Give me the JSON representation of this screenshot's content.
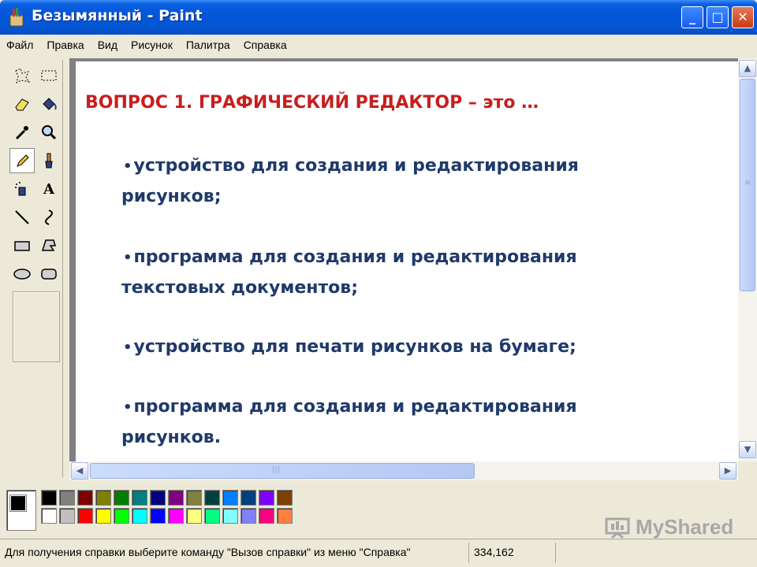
{
  "window": {
    "title": "Безымянный - Paint",
    "minimize_label": "_",
    "maximize_label": "□",
    "close_label": "✕"
  },
  "menu": [
    "Файл",
    "Правка",
    "Вид",
    "Рисунок",
    "Палитра",
    "Справка"
  ],
  "toolbox": {
    "selected_tool": "pencil-icon",
    "tools": [
      "free-select-icon",
      "rect-select-icon",
      "eraser-icon",
      "fill-icon",
      "color-picker-icon",
      "magnifier-icon",
      "pencil-icon",
      "brush-icon",
      "airbrush-icon",
      "text-icon",
      "line-icon",
      "curve-icon",
      "rectangle-icon",
      "polygon-icon",
      "ellipse-icon",
      "rounded-rect-icon"
    ],
    "text_tool_glyph": "A"
  },
  "canvas": {
    "question": "ВОПРОС 1. ГРАФИЧЕСКИЙ РЕДАКТОР  – это …",
    "answers": [
      [
        "устройство для создания и редактирования",
        "рисунков;"
      ],
      [
        "программа  для создания и редактирования",
        "текстовых документов;"
      ],
      [
        "устройство для печати рисунков на бумаге;"
      ],
      [
        "программа для создания и редактирования",
        "рисунков."
      ]
    ],
    "bullet": "•"
  },
  "scrollbars": {
    "up": "▲",
    "down": "▼",
    "left": "◀",
    "right": "▶",
    "grip": "≡",
    "hgrip": "|||"
  },
  "palette": {
    "foreground": "#000000",
    "background": "#ffffff",
    "row1": [
      "#000000",
      "#808080",
      "#800000",
      "#808000",
      "#008000",
      "#008080",
      "#000080",
      "#800080",
      "#808040",
      "#004040",
      "#0080ff",
      "#004080",
      "#8000ff",
      "#804000"
    ],
    "row2": [
      "#ffffff",
      "#c0c0c0",
      "#ff0000",
      "#ffff00",
      "#00ff00",
      "#00ffff",
      "#0000ff",
      "#ff00ff",
      "#ffff80",
      "#00ff80",
      "#80ffff",
      "#8080ff",
      "#ff0080",
      "#ff8040"
    ]
  },
  "watermark": "MyShared",
  "status": {
    "help": "Для получения справки выберите команду \"Вызов справки\" из меню \"Справка\"",
    "coords": "334,162"
  }
}
